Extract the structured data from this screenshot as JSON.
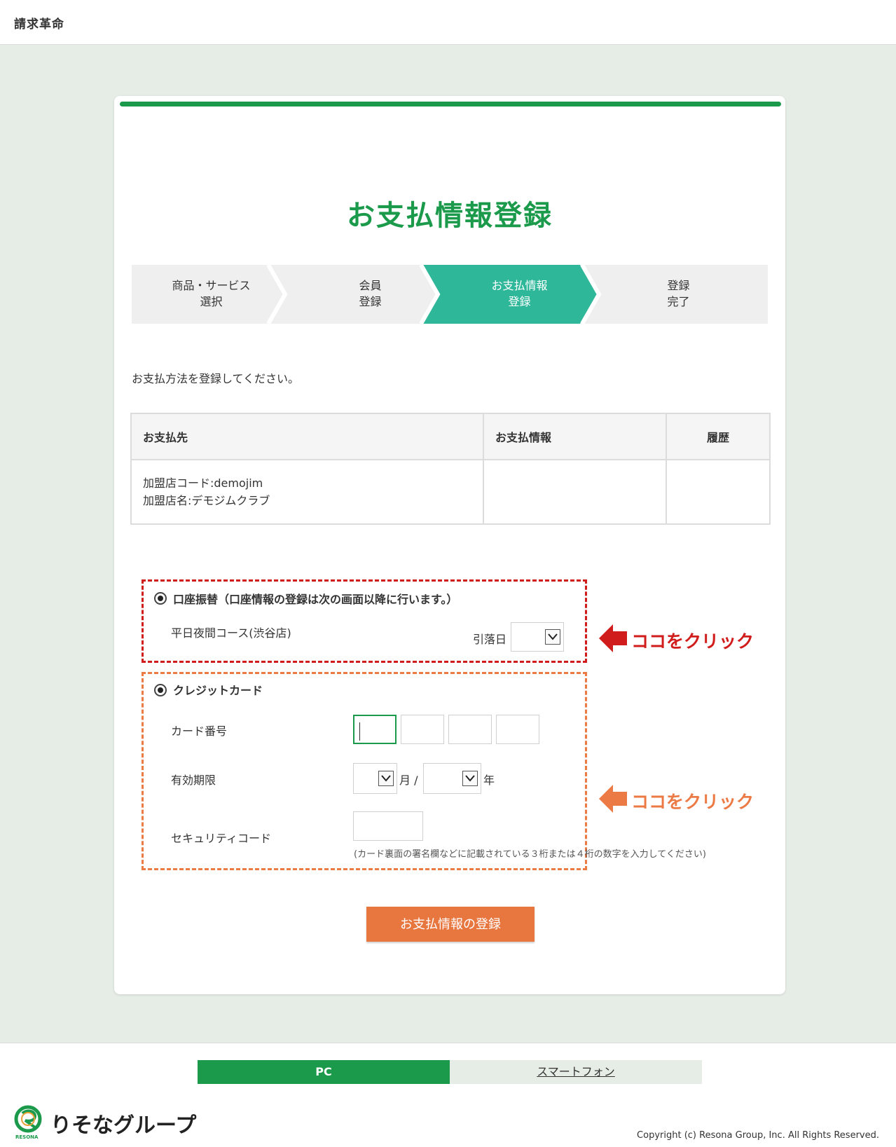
{
  "app": {
    "brand": "請求革命"
  },
  "page": {
    "title": "お支払情報登録",
    "intro": "お支払方法を登録してください。"
  },
  "steps": [
    {
      "line1": "商品・サービス",
      "line2": "選択",
      "active": false
    },
    {
      "line1": "会員",
      "line2": "登録",
      "active": false
    },
    {
      "line1": "お支払情報",
      "line2": "登録",
      "active": true
    },
    {
      "line1": "登録",
      "line2": "完了",
      "active": false
    }
  ],
  "table": {
    "headers": {
      "payee": "お支払先",
      "payment_info": "お支払情報",
      "history": "履歴"
    },
    "row": {
      "merchant_code": "加盟店コード:demojim",
      "merchant_name": "加盟店名:デモジムクラブ",
      "payment_info": "",
      "history": ""
    }
  },
  "bank_transfer": {
    "label": "口座振替（口座情報の登録は次の画面以降に行います。）",
    "course": "平日夜間コース(渋谷店)",
    "withdrawal_day_label": "引落日",
    "withdrawal_day_value": ""
  },
  "credit_card": {
    "label": "クレジットカード",
    "card_number_label": "カード番号",
    "expiry_label": "有効期限",
    "month_unit": "月 /",
    "year_unit": "年",
    "security_label": "セキュリティコード",
    "security_note": "(カード裏面の署名欄などに記載されている３桁または４桁の数字を入力してください)"
  },
  "submit_label": "お支払情報の登録",
  "callouts": [
    {
      "text": "ココをクリック",
      "color": "#d11c1c"
    },
    {
      "text": "ココをクリック",
      "color": "#ec7a45"
    }
  ],
  "footer": {
    "tab_pc": "PC",
    "tab_smartphone": "スマートフォン",
    "logo_text": "りそなグループ",
    "logo_sub": "RESONA",
    "copyright": "Copyright (c) Resona Group, Inc. All Rights Reserved."
  },
  "colors": {
    "brand_green": "#1b9a4b",
    "step_active": "#2fb79a",
    "submit_orange": "#e8763f",
    "callout_red": "#d11c1c",
    "callout_orange": "#ec7a45"
  }
}
